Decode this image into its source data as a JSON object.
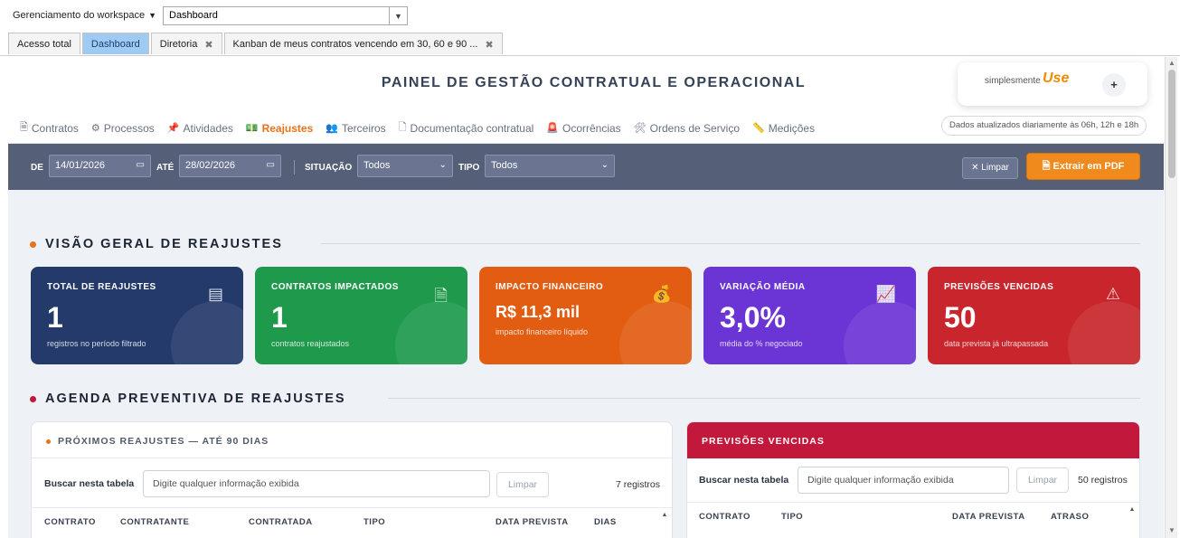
{
  "workspace": {
    "label": "Gerenciamento do workspace",
    "selected": "Dashboard"
  },
  "tabs": [
    {
      "label": "Acesso total",
      "closable": false,
      "active": false
    },
    {
      "label": "Dashboard",
      "closable": false,
      "active": true
    },
    {
      "label": "Diretoria",
      "closable": true,
      "active": false
    },
    {
      "label": "Kanban de meus contratos vencendo em 30, 60 e 90 ...",
      "closable": true,
      "active": false
    }
  ],
  "header": {
    "title": "PAINEL DE GESTÃO CONTRATUAL E OPERACIONAL",
    "logo_prefix": "simplesmente",
    "logo_main": "Use",
    "logo_plus": "+"
  },
  "nav": [
    {
      "label": "Contratos",
      "icon": "document-icon",
      "glyph": "🗎"
    },
    {
      "label": "Processos",
      "icon": "gear-icon",
      "glyph": "⚙"
    },
    {
      "label": "Atividades",
      "icon": "pin-icon",
      "glyph": "📌"
    },
    {
      "label": "Reajustes",
      "icon": "money-icon",
      "glyph": "💵",
      "active": true
    },
    {
      "label": "Terceiros",
      "icon": "people-icon",
      "glyph": "👥"
    },
    {
      "label": "Documentação contratual",
      "icon": "file-icon",
      "glyph": "🗋"
    },
    {
      "label": "Ocorrências",
      "icon": "siren-icon",
      "glyph": "🚨"
    },
    {
      "label": "Ordens de Serviço",
      "icon": "tools-icon",
      "glyph": "🛠"
    },
    {
      "label": "Medições",
      "icon": "ruler-icon",
      "glyph": "📏"
    }
  ],
  "updated_note": "Dados atualizados diariamente às 06h, 12h e 18h",
  "filters": {
    "de_label": "DE",
    "de_value": "14/01/2026",
    "ate_label": "ATÉ",
    "ate_value": "28/02/2026",
    "situacao_label": "SITUAÇÃO",
    "situacao_value": "Todos",
    "tipo_label": "TIPO",
    "tipo_value": "Todos",
    "clear_label": "✕ Limpar",
    "pdf_label": "Extrair em PDF"
  },
  "overview": {
    "title": "VISÃO GERAL DE REAJUSTES",
    "cards": [
      {
        "label": "TOTAL DE REAJUSTES",
        "value": "1",
        "sub": "registros no período filtrado",
        "icon": "calculator-icon",
        "glyph": "▤",
        "color": "#233a6b"
      },
      {
        "label": "CONTRATOS IMPACTADOS",
        "value": "1",
        "sub": "contratos reajustados",
        "icon": "contract-icon",
        "glyph": "🗎",
        "color": "#1f9a4d"
      },
      {
        "label": "IMPACTO FINANCEIRO",
        "value": "R$ 11,3 mil",
        "sub": "impacto financeiro líquido",
        "icon": "money-bag-icon",
        "glyph": "💰",
        "color": "#e25d12"
      },
      {
        "label": "VARIAÇÃO MÉDIA",
        "value": "3,0%",
        "sub": "média do % negociado",
        "icon": "chart-icon",
        "glyph": "📈",
        "color": "#6b35d6"
      },
      {
        "label": "PREVISÕES VENCIDAS",
        "value": "50",
        "sub": "data prevista já ultrapassada",
        "icon": "warning-icon",
        "glyph": "⚠",
        "color": "#c8262c"
      }
    ]
  },
  "agenda": {
    "title": "AGENDA PREVENTIVA DE REAJUSTES",
    "left": {
      "title": "PRÓXIMOS REAJUSTES — ATÉ 90 DIAS",
      "search_label": "Buscar nesta tabela",
      "search_placeholder": "Digite qualquer informação exibida",
      "clear_label": "Limpar",
      "count": "7 registros",
      "columns": [
        "CONTRATO",
        "CONTRATANTE",
        "CONTRATADA",
        "TIPO",
        "DATA PREVISTA",
        "DIAS"
      ]
    },
    "right": {
      "title": "PREVISÕES VENCIDAS",
      "search_label": "Buscar nesta tabela",
      "search_placeholder": "Digite qualquer informação exibida",
      "clear_label": "Limpar",
      "count": "50 registros",
      "columns": [
        "CONTRATO",
        "TIPO",
        "DATA PREVISTA",
        "ATRASO"
      ]
    }
  },
  "colors": {
    "accent_orange": "#e8731a",
    "filter_bar": "#555f77",
    "tab_active": "#9fcbf3",
    "danger_red": "#c2183b"
  }
}
